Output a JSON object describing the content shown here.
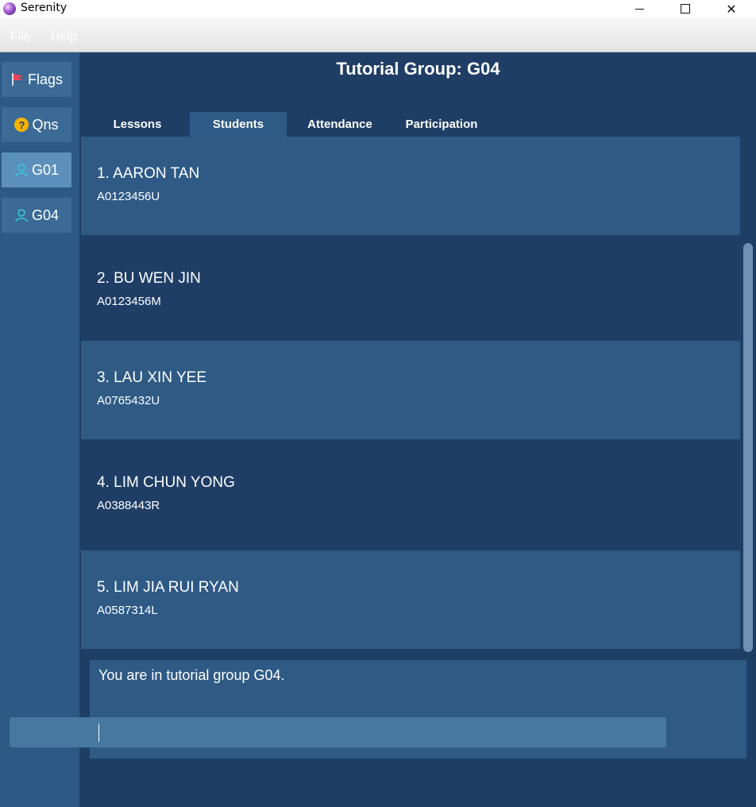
{
  "window": {
    "title": "Serenity",
    "minimize_label": "",
    "maximize_label": "",
    "close_label": "✕"
  },
  "menu": {
    "file": "File",
    "help": "Help"
  },
  "sidebar": {
    "items": [
      {
        "label": "Flags",
        "icon": "flag-icon"
      },
      {
        "label": "Qns",
        "icon": "question-icon"
      },
      {
        "label": "G01",
        "icon": "person-icon",
        "active": true
      },
      {
        "label": "G04",
        "icon": "person-icon"
      }
    ]
  },
  "main": {
    "title": "Tutorial Group: G04",
    "tabs": [
      {
        "label": "Lessons"
      },
      {
        "label": "Students",
        "active": true
      },
      {
        "label": "Attendance"
      },
      {
        "label": "Participation"
      }
    ],
    "students": [
      {
        "name": "1.  AARON TAN",
        "id": "A0123456U"
      },
      {
        "name": "2.  BU WEN JIN",
        "id": "A0123456M"
      },
      {
        "name": "3.  LAU XIN YEE",
        "id": "A0765432U"
      },
      {
        "name": "4.  LIM CHUN YONG",
        "id": "A0388443R"
      },
      {
        "name": "5.  LIM JIA RUI RYAN",
        "id": "A0587314L"
      }
    ],
    "result": "You are in tutorial group G04.",
    "command_value": ""
  },
  "colors": {
    "background": "#1f3e66",
    "card_light": "#2e5a85",
    "sidebar": "#2c5985",
    "sidebar_active": "#5c90bc",
    "command_box": "#4678a0",
    "flag": "#e8445a",
    "question": "#f5b400",
    "person": "#3ec6d6"
  }
}
